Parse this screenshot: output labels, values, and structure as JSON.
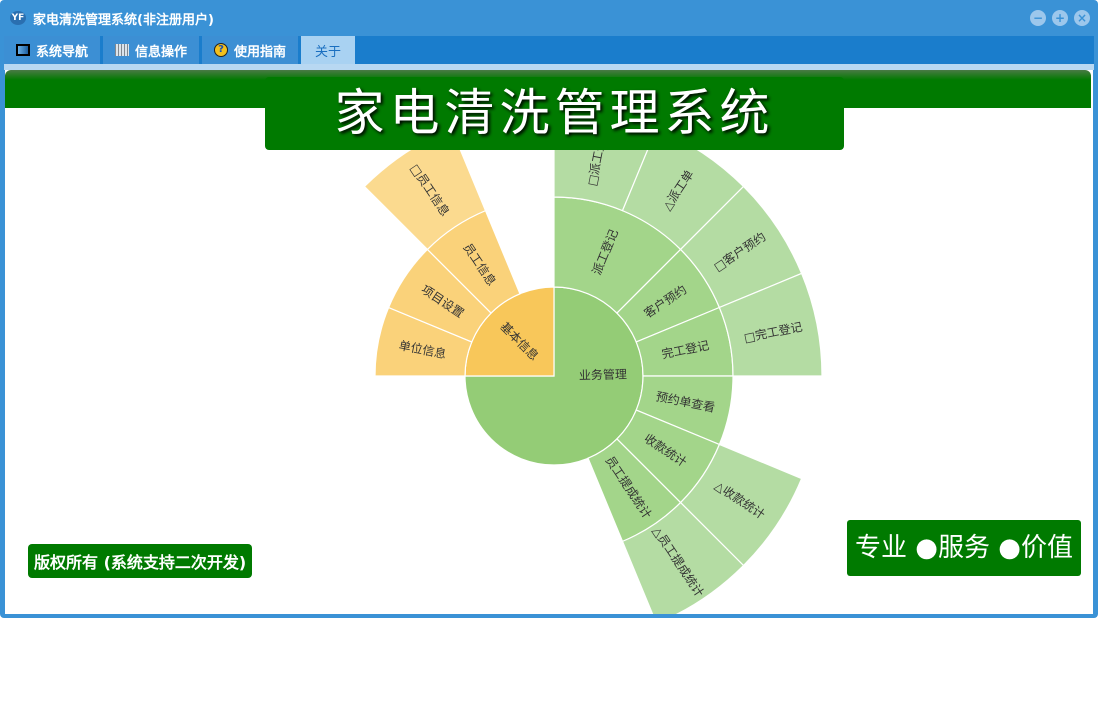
{
  "window": {
    "title": "家电清洗管理系统(非注册用户)",
    "logo": "YF",
    "controls": [
      "minimize-icon",
      "restore-icon",
      "close-icon"
    ]
  },
  "tabs": [
    {
      "label": "系统导航",
      "icon": "monitor-icon"
    },
    {
      "label": "信息操作",
      "icon": "grid-icon"
    },
    {
      "label": "使用指南",
      "icon": "help-icon"
    },
    {
      "label": "关于",
      "icon": ""
    }
  ],
  "banner": {
    "title": "家电清洗管理系统"
  },
  "footer": {
    "copyright": "版权所有 (系统支持二次开发)",
    "slogan": "专业 ●服务 ●价值"
  },
  "colors": {
    "green": [
      "#94cc76",
      "#a3d58a",
      "#b4dca3"
    ],
    "orange": [
      "#f8c75a",
      "#fad27a",
      "#fbda8f"
    ],
    "brand": "#007a00"
  },
  "chart_data": {
    "type": "sunburst",
    "start_angle_deg_clockwise_from_top": 0,
    "total": 16,
    "nodes": [
      {
        "name": "业务管理",
        "value": 12,
        "color": "green",
        "children": [
          {
            "name": "派工登记",
            "value": 2,
            "children": [
              {
                "name": "□派工登记",
                "value": 1
              },
              {
                "name": "△派工单",
                "value": 1
              }
            ]
          },
          {
            "name": "客户预约",
            "value": 1,
            "children": [
              {
                "name": "□客户预约",
                "value": 1
              }
            ]
          },
          {
            "name": "完工登记",
            "value": 1,
            "children": [
              {
                "name": "□完工登记",
                "value": 1
              }
            ]
          },
          {
            "name": "预约单查看",
            "value": 1,
            "children": []
          },
          {
            "name": "收款统计",
            "value": 1,
            "children": [
              {
                "name": "△收款统计",
                "value": 1
              }
            ]
          },
          {
            "name": "员工提成统计",
            "value": 1,
            "children": [
              {
                "name": "△员工提成统计",
                "value": 1
              }
            ]
          }
        ]
      },
      {
        "name": "基本信息",
        "value": 4,
        "color": "orange",
        "children": [
          {
            "name": "单位信息",
            "value": 1,
            "children": []
          },
          {
            "name": "项目设置",
            "value": 1,
            "children": []
          },
          {
            "name": "员工信息",
            "value": 1,
            "children": [
              {
                "name": "□员工信息",
                "value": 1
              }
            ]
          }
        ]
      }
    ]
  }
}
